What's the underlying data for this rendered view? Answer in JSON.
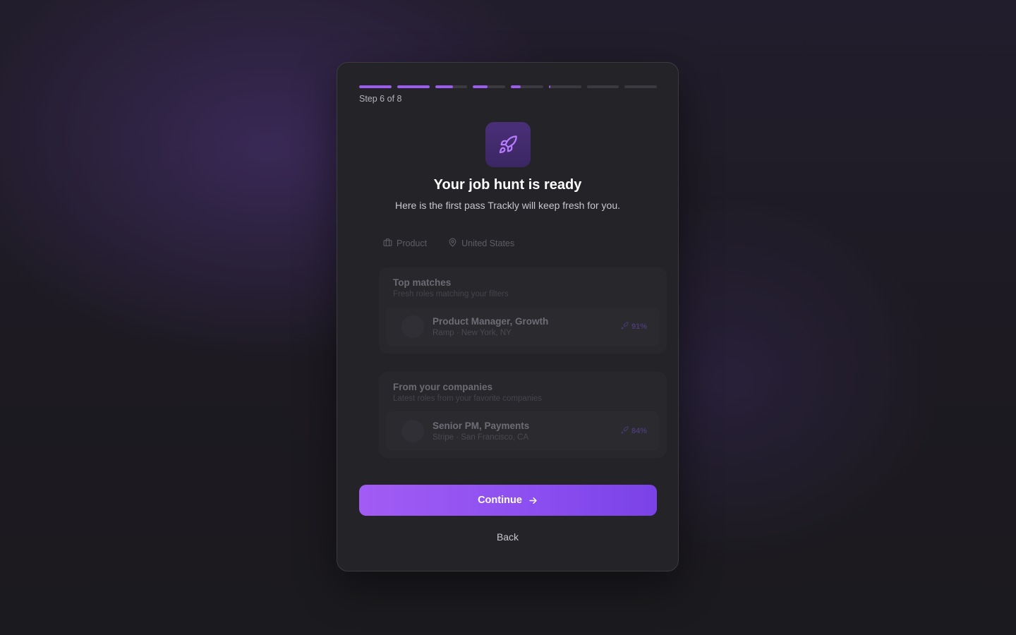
{
  "progress": {
    "label": "Step 6 of 8",
    "segments": [
      1,
      1,
      0.55,
      0.45,
      0.3,
      0.05,
      0,
      0
    ],
    "accent_color": "#9b5cf0"
  },
  "hero": {
    "icon": "rocket-icon",
    "title": "Your job hunt is ready",
    "subtitle": "Here is the first pass Trackly will keep fresh for you."
  },
  "filters": [
    {
      "icon": "briefcase-icon",
      "label": "Product"
    },
    {
      "icon": "map-pin-icon",
      "label": "United States"
    }
  ],
  "sections": [
    {
      "title": "Top matches",
      "subtitle": "Fresh roles matching your filters",
      "jobs": [
        {
          "title": "Product Manager, Growth",
          "meta": "Ramp · New York, NY",
          "match": "91%"
        }
      ]
    },
    {
      "title": "From your companies",
      "subtitle": "Latest roles from your favorite companies",
      "jobs": [
        {
          "title": "Senior PM, Payments",
          "meta": "Stripe · San Francisco, CA",
          "match": "84%"
        }
      ]
    }
  ],
  "actions": {
    "continue_label": "Continue",
    "back_label": "Back"
  }
}
